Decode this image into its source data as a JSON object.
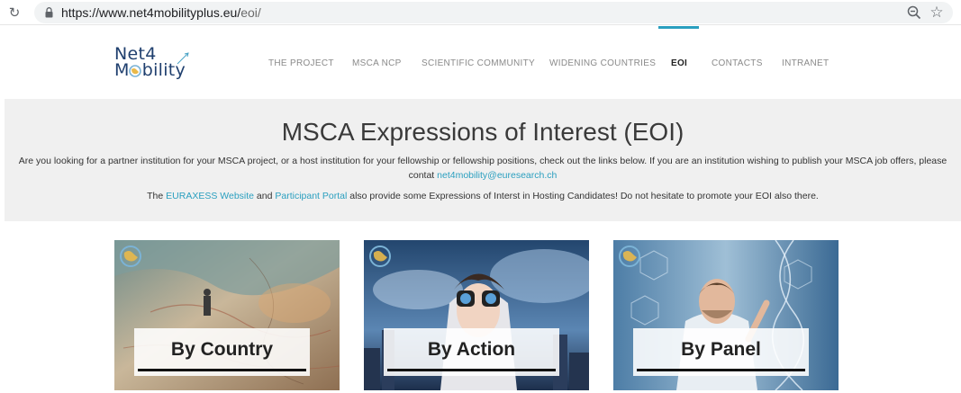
{
  "browser": {
    "url_host": "https://www.net4mobilityplus.eu/",
    "url_path": "eoi/"
  },
  "logo": {
    "line1": "Net4",
    "line2_prefix": "M",
    "line2_suffix": "bility"
  },
  "nav": {
    "items": [
      {
        "label": "THE PROJECT",
        "active": false
      },
      {
        "label": "MSCA NCP",
        "active": false
      },
      {
        "label": "SCIENTIFIC COMMUNITY",
        "active": false
      },
      {
        "label": "WIDENING COUNTRIES",
        "active": false
      },
      {
        "label": "EOI",
        "active": true
      },
      {
        "label": "CONTACTS",
        "active": false
      },
      {
        "label": "INTRANET",
        "active": false
      }
    ],
    "accent_color": "#2a9fbf"
  },
  "hero": {
    "title": "MSCA Expressions of Interest (EOI)",
    "intro_line1": "Are you looking for a partner institution for your MSCA project, or a host institution for your fellowship or fellowship positions, check out the links below. If you are an institution wishing to publish your MSCA job offers, please",
    "intro_line2_prefix": "contat ",
    "intro_email": "net4mobility@euresearch.ch",
    "note_prefix": "The ",
    "note_link1": "EURAXESS Website",
    "note_mid": " and ",
    "note_link2": "Participant Portal",
    "note_suffix": " also provide some Expressions of Interst in Hosting Candidates! Do not hesitate to promote your EOI also there."
  },
  "cards": [
    {
      "label": "By Country"
    },
    {
      "label": "By Action"
    },
    {
      "label": "By Panel"
    }
  ]
}
